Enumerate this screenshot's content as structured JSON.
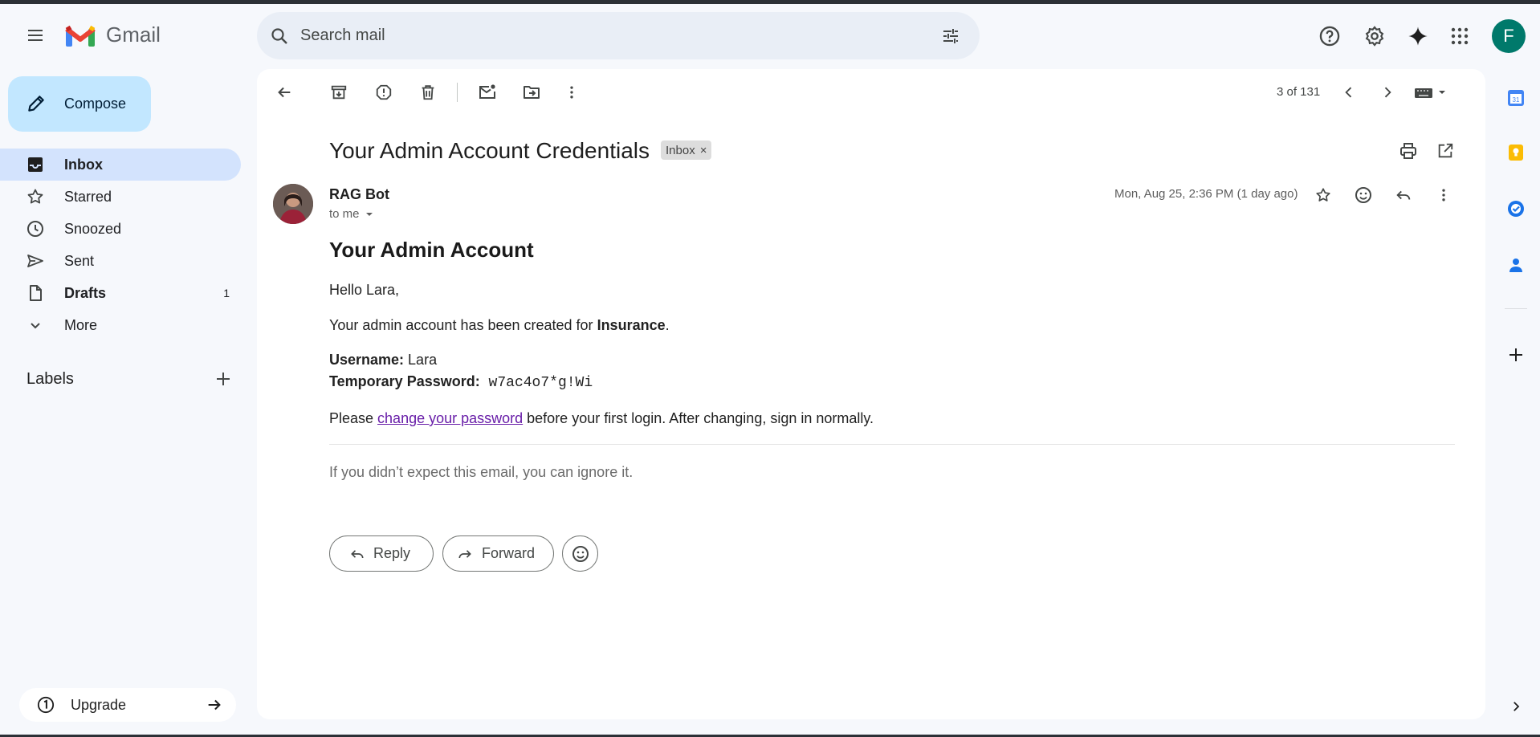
{
  "app": {
    "name": "Gmail"
  },
  "search": {
    "placeholder": "Search mail"
  },
  "account": {
    "initial": "F",
    "color": "#00796b"
  },
  "sidebar": {
    "compose_label": "Compose",
    "items": [
      {
        "label": "Inbox",
        "count": ""
      },
      {
        "label": "Starred",
        "count": ""
      },
      {
        "label": "Snoozed",
        "count": ""
      },
      {
        "label": "Sent",
        "count": ""
      },
      {
        "label": "Drafts",
        "count": "1"
      },
      {
        "label": "More",
        "count": ""
      }
    ],
    "labels_heading": "Labels",
    "upgrade_label": "Upgrade"
  },
  "toolbar": {
    "pagination": "3 of 131"
  },
  "email": {
    "subject": "Your Admin Account Credentials",
    "chip": "Inbox",
    "chip_close": "×",
    "sender": "RAG Bot",
    "recipient": "to me",
    "date": "Mon, Aug 25, 2:36 PM (1 day ago)",
    "heading": "Your Admin Account",
    "greeting": "Hello Lara,",
    "created_prefix": "Your admin account has been created for ",
    "created_org": "Insurance",
    "created_suffix": ".",
    "username_label": "Username:",
    "username_value": " Lara",
    "password_label": "Temporary Password:",
    "password_value": " w7ac4o7*g!Wi",
    "please_prefix": "Please ",
    "link_text": "change your password",
    "please_suffix": " before your first login. After changing, sign in normally.",
    "footer": "If you didn’t expect this email, you can ignore it."
  },
  "actions": {
    "reply": "Reply",
    "forward": "Forward"
  },
  "colors": {
    "accent": "#0b57d0",
    "compose_bg": "#c2e7ff",
    "active_nav": "#d3e3fd",
    "link": "#681da8"
  }
}
